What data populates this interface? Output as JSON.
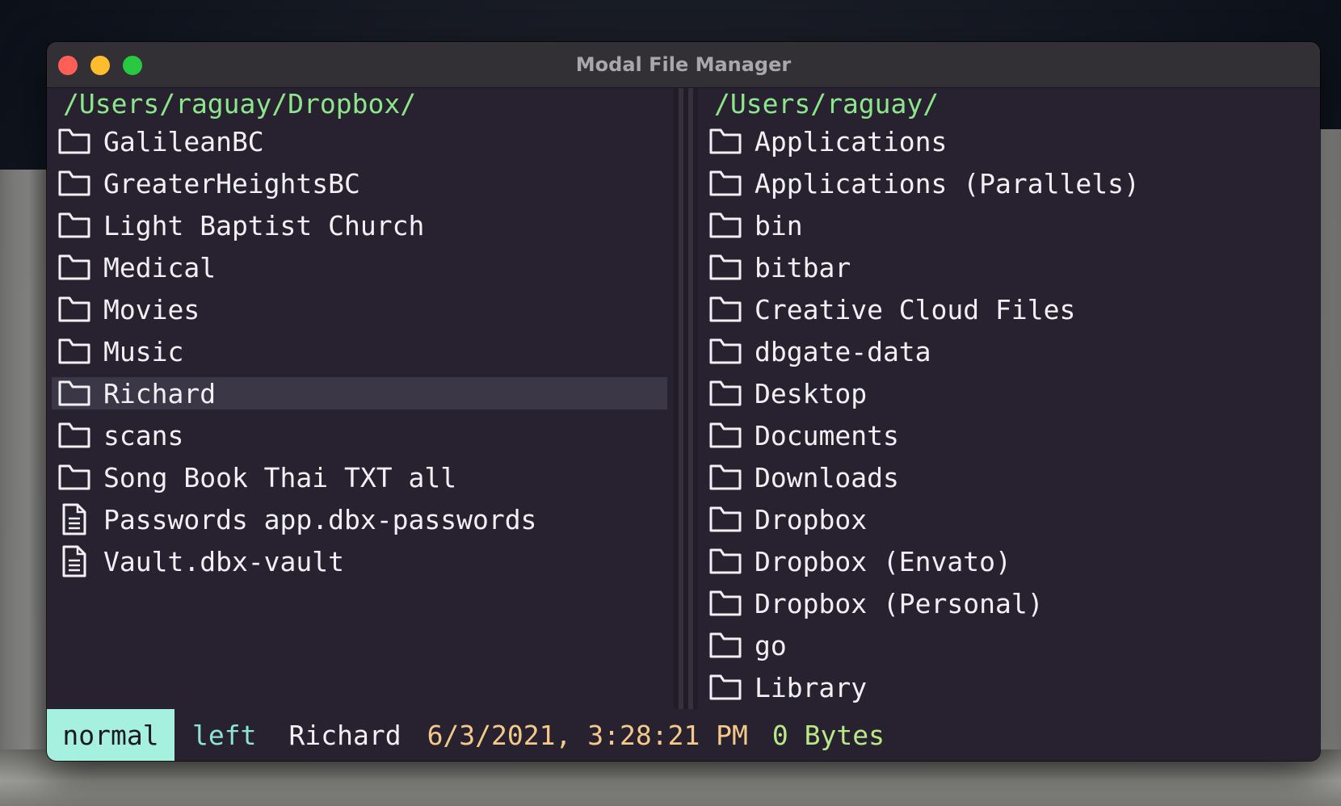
{
  "window": {
    "title": "Modal File Manager"
  },
  "left_pane": {
    "path": "/Users/raguay/Dropbox/",
    "items": [
      {
        "name": "GalileanBC",
        "type": "folder"
      },
      {
        "name": "GreaterHeightsBC",
        "type": "folder"
      },
      {
        "name": "Light Baptist Church",
        "type": "folder"
      },
      {
        "name": "Medical",
        "type": "folder"
      },
      {
        "name": "Movies",
        "type": "folder"
      },
      {
        "name": "Music",
        "type": "folder"
      },
      {
        "name": "Richard",
        "type": "folder",
        "selected": true
      },
      {
        "name": "scans",
        "type": "folder"
      },
      {
        "name": "Song Book Thai TXT all",
        "type": "folder"
      },
      {
        "name": "Passwords app.dbx-passwords",
        "type": "file"
      },
      {
        "name": "Vault.dbx-vault",
        "type": "file"
      }
    ]
  },
  "right_pane": {
    "path": "/Users/raguay/",
    "items": [
      {
        "name": "Applications",
        "type": "folder"
      },
      {
        "name": "Applications (Parallels)",
        "type": "folder"
      },
      {
        "name": "bin",
        "type": "folder"
      },
      {
        "name": "bitbar",
        "type": "folder"
      },
      {
        "name": "Creative Cloud Files",
        "type": "folder"
      },
      {
        "name": "dbgate-data",
        "type": "folder"
      },
      {
        "name": "Desktop",
        "type": "folder"
      },
      {
        "name": "Documents",
        "type": "folder"
      },
      {
        "name": "Downloads",
        "type": "folder"
      },
      {
        "name": "Dropbox",
        "type": "folder"
      },
      {
        "name": "Dropbox (Envato)",
        "type": "folder"
      },
      {
        "name": "Dropbox (Personal)",
        "type": "folder"
      },
      {
        "name": "go",
        "type": "folder"
      },
      {
        "name": "Library",
        "type": "folder"
      }
    ]
  },
  "status": {
    "mode": "normal",
    "pane": "left",
    "selected_name": "Richard",
    "modified": "6/3/2021, 3:28:21 PM",
    "size": "0 Bytes"
  },
  "icons": {
    "folder": "folder-icon",
    "file": "document-icon"
  },
  "colors": {
    "path": "#8ce68c",
    "mode_badge": "#a6f0e0",
    "pane_side": "#8ee3d6",
    "date": "#f4c98a",
    "size": "#b8e986",
    "selection": "#3c3747",
    "background": "#282230"
  }
}
